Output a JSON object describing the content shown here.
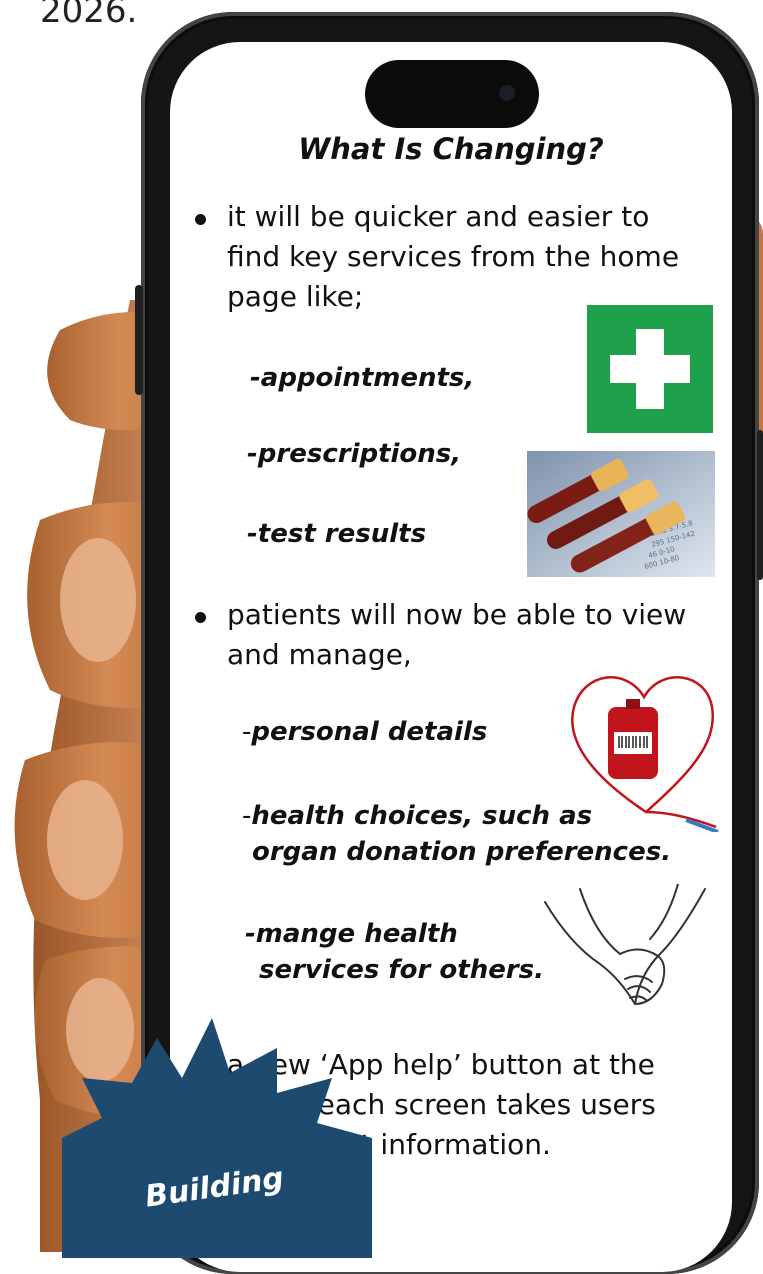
{
  "top_text": "2026.",
  "screen": {
    "title": "What Is Changing?",
    "bullet1": {
      "line1": "it will be quicker and easier to",
      "line2": "find key services from the home",
      "line3": "page like;"
    },
    "services": {
      "appointments": "-appointments,",
      "prescriptions": "-prescriptions,",
      "test_results": "-test results"
    },
    "bullet2": {
      "line1": "patients will now be able to view",
      "line2": "and manage,"
    },
    "manage": {
      "personal_dash": "-",
      "personal_details": "personal details",
      "health_dash": "-",
      "health_line1": "health choices, such as",
      "health_line2": "organ  donation preferences.",
      "others_line1": "-mange health",
      "others_line2": "services for others."
    },
    "bullet3": {
      "line1": "a new ‘App help’ button at the",
      "line2": "top of each screen takes users",
      "line3": "to support information."
    }
  },
  "badge": {
    "label": "Building",
    "color": "#1e4a70"
  },
  "colors": {
    "first_aid_green": "#1fa04a",
    "blood_red": "#c0151c"
  }
}
